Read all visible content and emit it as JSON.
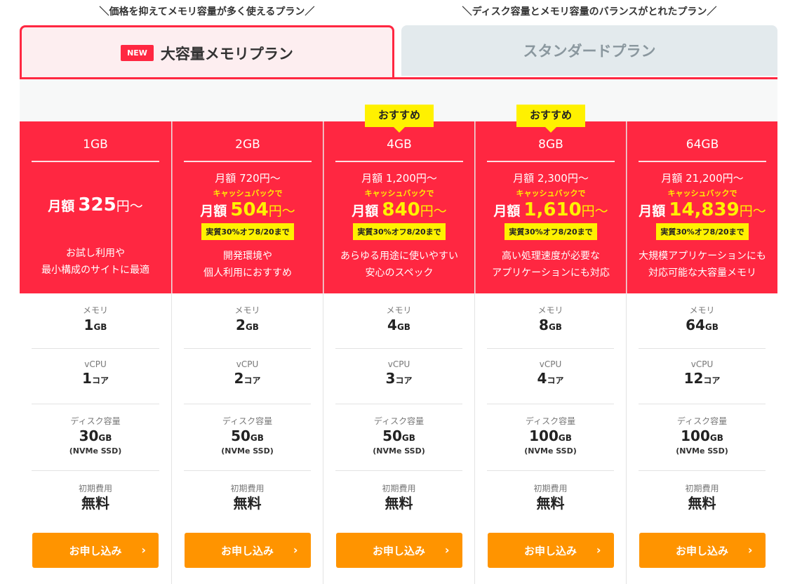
{
  "tabs": {
    "large_memory": {
      "description": "＼価格を抑えてメモリ容量が多く使えるプラン／",
      "badge": "NEW",
      "label": "大容量メモリプラン"
    },
    "standard": {
      "description": "＼ディスク容量とメモリ容量のバランスがとれたプラン／",
      "label": "スタンダードプラン"
    }
  },
  "labels": {
    "memory": "メモリ",
    "vcpu": "vCPU",
    "disk": "ディスク容量",
    "initial_fee": "初期費用",
    "apply": "お申し込み",
    "cashback": "キャッシュバックで",
    "price_prefix": "月額",
    "price_suffix": "円～",
    "nvme": "(NVMe SSD)",
    "recommended": "おすすめ"
  },
  "colors": {
    "brand_red": "#ff2741",
    "accent_yellow": "#fff100",
    "button_orange": "#ff9400"
  },
  "plans": [
    {
      "capacity": "1GB",
      "price": "325",
      "desc1": "お試し利用や",
      "desc2": "最小構成のサイトに最適",
      "memory": "1",
      "memory_unit": "GB",
      "vcpu": "1",
      "vcpu_unit": "コア",
      "disk": "30",
      "disk_unit": "GB",
      "initial": "無料"
    },
    {
      "capacity": "2GB",
      "monthly": "月額 720円～",
      "price": "504",
      "promo": "実質30%オフ8/20まで",
      "desc1": "開発環境や",
      "desc2": "個人利用におすすめ",
      "memory": "2",
      "memory_unit": "GB",
      "vcpu": "2",
      "vcpu_unit": "コア",
      "disk": "50",
      "disk_unit": "GB",
      "initial": "無料"
    },
    {
      "capacity": "4GB",
      "monthly": "月額 1,200円～",
      "price": "840",
      "promo": "実質30%オフ8/20まで",
      "desc1": "あらゆる用途に使いやすい",
      "desc2": "安心のスペック",
      "memory": "4",
      "memory_unit": "GB",
      "vcpu": "3",
      "vcpu_unit": "コア",
      "disk": "50",
      "disk_unit": "GB",
      "initial": "無料"
    },
    {
      "capacity": "8GB",
      "monthly": "月額 2,300円～",
      "price": "1,610",
      "promo": "実質30%オフ8/20まで",
      "desc1": "高い処理速度が必要な",
      "desc2": "アプリケーションにも対応",
      "memory": "8",
      "memory_unit": "GB",
      "vcpu": "4",
      "vcpu_unit": "コア",
      "disk": "100",
      "disk_unit": "GB",
      "initial": "無料"
    },
    {
      "capacity": "64GB",
      "monthly": "月額 21,200円～",
      "price": "14,839",
      "promo": "実質30%オフ8/20まで",
      "desc1": "大規模アプリケーションにも",
      "desc2": "対応可能な大容量メモリ",
      "memory": "64",
      "memory_unit": "GB",
      "vcpu": "12",
      "vcpu_unit": "コア",
      "disk": "100",
      "disk_unit": "GB",
      "initial": "無料"
    }
  ]
}
